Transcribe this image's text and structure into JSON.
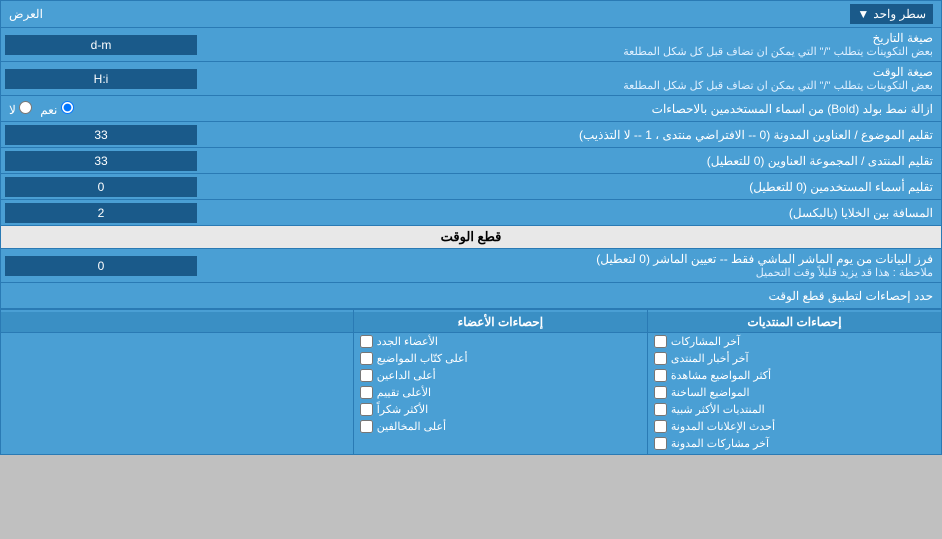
{
  "header": {
    "label_right": "العرض",
    "dropdown_label": "سطر واحد"
  },
  "rows": [
    {
      "id": "date_format",
      "label": "صيغة التاريخ",
      "sublabel": "بعض التكوينات يتطلب \"/\" التي يمكن ان تضاف قبل كل شكل المطلعة",
      "value": "d-m",
      "type": "input"
    },
    {
      "id": "time_format",
      "label": "صيغة الوقت",
      "sublabel": "بعض التكوينات يتطلب \"/\" التي يمكن ان تضاف قبل كل شكل المطلعة",
      "value": "H:i",
      "type": "input"
    },
    {
      "id": "bold_remove",
      "label": "ازالة نمط بولد (Bold) من اسماء المستخدمين بالاحصاءات",
      "radio_yes": "نعم",
      "radio_no": "لا",
      "selected": "yes",
      "type": "radio"
    },
    {
      "id": "topic_address",
      "label": "تقليم الموضوع / العناوين المدونة (0 -- الافتراضي منتدى ، 1 -- لا التذذيب)",
      "value": "33",
      "type": "input"
    },
    {
      "id": "forum_address",
      "label": "تقليم المنتدى / المجموعة العناوين (0 للتعطيل)",
      "value": "33",
      "type": "input"
    },
    {
      "id": "users_address",
      "label": "تقليم أسماء المستخدمين (0 للتعطيل)",
      "value": "0",
      "type": "input"
    },
    {
      "id": "cell_spacing",
      "label": "المسافة بين الخلايا (بالبكسل)",
      "value": "2",
      "type": "input"
    }
  ],
  "section_cutoff": {
    "title": "قطع الوقت",
    "row": {
      "label": "فرز البيانات من يوم الماشر الماشي فقط -- تعيين الماشر (0 لتعطيل)",
      "note": "ملاحظة : هذا قد يزيد قليلاً وقت التحميل",
      "value": "0"
    },
    "stats_label": "حدد إحصاءات لتطبيق قطع الوقت"
  },
  "checkboxes": {
    "col1_header": "إحصاءات المنتديات",
    "col2_header": "إحصاءات الأعضاء",
    "col1_items": [
      {
        "label": "آخر المشاركات",
        "checked": false
      },
      {
        "label": "آخر أخبار المنتدى",
        "checked": false
      },
      {
        "label": "أكثر المواضيع مشاهدة",
        "checked": false
      },
      {
        "label": "المواضيع الساخنة",
        "checked": false
      },
      {
        "label": "المنتديات الأكثر شبية",
        "checked": false
      },
      {
        "label": "أحدث الإعلانات المدونة",
        "checked": false
      },
      {
        "label": "آخر مشاركات المدونة",
        "checked": false
      }
    ],
    "col2_items": [
      {
        "label": "الأعضاء الجدد",
        "checked": false
      },
      {
        "label": "أعلى كتّاب المواضيع",
        "checked": false
      },
      {
        "label": "أعلى الداعين",
        "checked": false
      },
      {
        "label": "الأعلى تقييم",
        "checked": false
      },
      {
        "label": "الأكثر شكراً",
        "checked": false
      },
      {
        "label": "أعلى المخالفين",
        "checked": false
      }
    ]
  },
  "colors": {
    "bg_main": "#4a9fd4",
    "bg_input": "#1a5a8a",
    "section_bg": "#e8e8e8",
    "border": "#2a7ab4"
  }
}
